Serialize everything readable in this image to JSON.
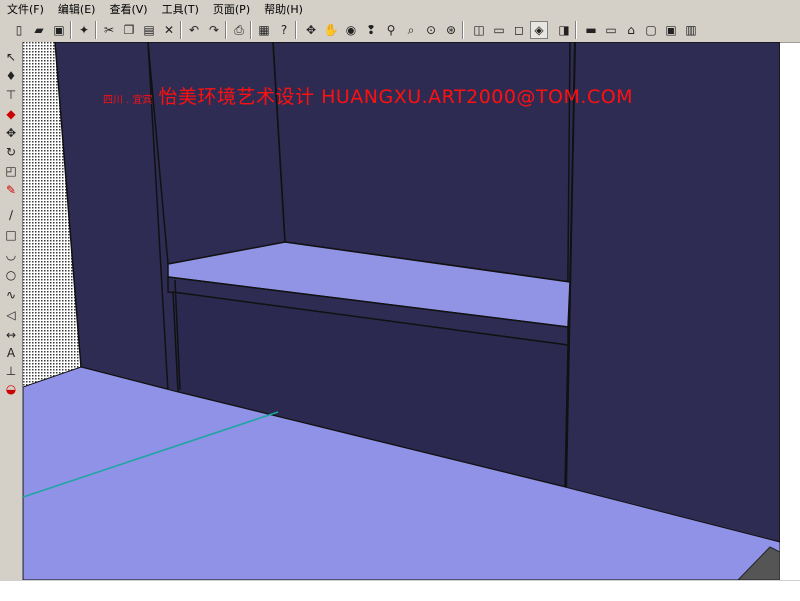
{
  "menu": [
    "文件(F)",
    "编辑(E)",
    "查看(V)",
    "工具(T)",
    "页面(P)",
    "帮助(H)"
  ],
  "banner": {
    "small": "四川 . 宜宾",
    "big": "怡美环境艺术设计  HUANGXU.ART2000@TOM.COM"
  },
  "toolbar_icons": [
    "new-file-icon",
    "open-folder-icon",
    "save-icon",
    "camera-icon",
    "cut-icon",
    "copy-icon",
    "paste-icon",
    "delete-icon",
    "undo-icon",
    "redo-icon",
    "print-icon",
    "model-info-icon",
    "help-icon",
    "orbit-icon",
    "pan-icon",
    "look-around-icon",
    "walk-icon",
    "zoom-icon",
    "zoom-window-icon",
    "zoom-extents-icon",
    "previous-view-icon",
    "iso-view-icon",
    "top-view-icon",
    "front-view-icon",
    "right-view-icon",
    "back-view-icon",
    "left-view-icon",
    "wireframe-icon",
    "hidden-line-icon",
    "shaded-icon",
    "shaded-texture-icon",
    "xray-icon",
    "section-icon",
    "component-icon"
  ],
  "left_tools": [
    "select-icon",
    "paint-bucket-icon",
    "tape-measure-icon",
    "eraser-icon",
    "move-icon",
    "rotate-icon",
    "scale-icon",
    "push-pull-icon",
    "line-icon",
    "rectangle-icon",
    "arc-icon",
    "circle-icon",
    "freehand-icon",
    "polygon-icon",
    "dimension-icon",
    "text-icon",
    "axis-icon",
    "protractor-icon"
  ],
  "colors": {
    "wall": "#2f2c54",
    "wall_dark": "#25223f",
    "floor": "#8f92e6",
    "bench_top": "#9194e5",
    "banner_text": "#ff1010",
    "axis_line": "#1aa6a0",
    "chrome": "#d4d0c8"
  }
}
